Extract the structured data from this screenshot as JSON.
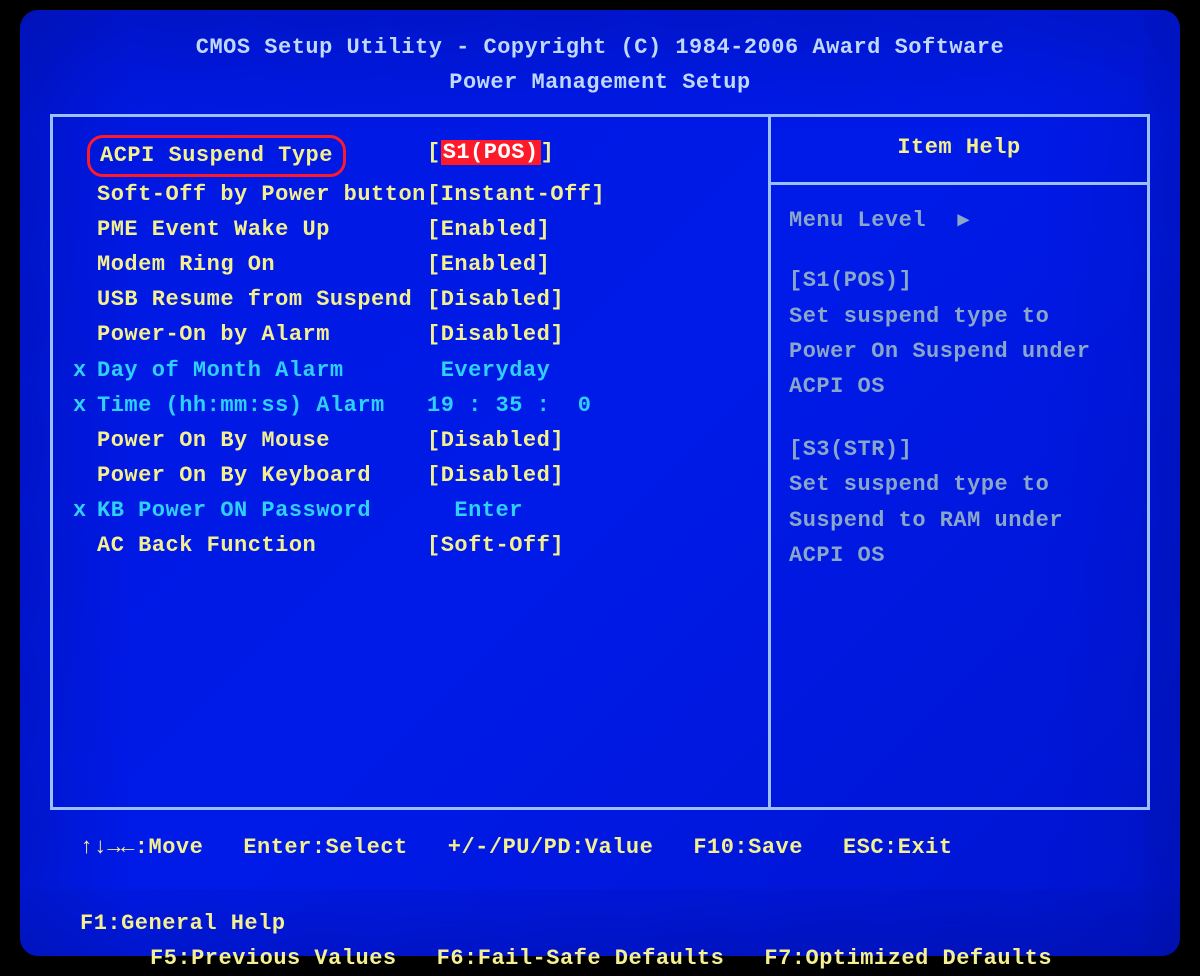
{
  "header": {
    "line1": "CMOS Setup Utility - Copyright (C) 1984-2006 Award Software",
    "line2": "Power Management Setup"
  },
  "items": [
    {
      "mark": "",
      "label": "ACPI Suspend Type",
      "value": "[",
      "sel": "S1(POS)",
      "tail": "]",
      "cls": "yellow",
      "selected": true
    },
    {
      "mark": "",
      "label": "Soft-Off by Power button",
      "value": "[Instant-Off]",
      "cls": "yellow"
    },
    {
      "mark": "",
      "label": "PME Event Wake Up",
      "value": "[Enabled]",
      "cls": "yellow"
    },
    {
      "mark": "",
      "label": "Modem Ring On",
      "value": "[Enabled]",
      "cls": "yellow"
    },
    {
      "mark": "",
      "label": "USB Resume from Suspend",
      "value": "[Disabled]",
      "cls": "yellow"
    },
    {
      "mark": "",
      "label": "Power-On by Alarm",
      "value": "[Disabled]",
      "cls": "yellow"
    },
    {
      "mark": "x",
      "label": "Day of Month Alarm",
      "value": " Everyday",
      "cls": "cyan"
    },
    {
      "mark": "x",
      "label": "Time (hh:mm:ss) Alarm",
      "value": "19 : 35 :  0",
      "cls": "cyan"
    },
    {
      "mark": "",
      "label": "Power On By Mouse",
      "value": "[Disabled]",
      "cls": "yellow"
    },
    {
      "mark": "",
      "label": "Power On By Keyboard",
      "value": "[Disabled]",
      "cls": "yellow"
    },
    {
      "mark": "x",
      "label": "KB Power ON Password",
      "value": "  Enter",
      "cls": "cyan"
    },
    {
      "mark": "",
      "label": "AC Back Function",
      "value": "[Soft-Off]",
      "cls": "yellow"
    }
  ],
  "help": {
    "title": "Item Help",
    "menu_level": "Menu Level",
    "arrow": "▸",
    "blocks": [
      {
        "head": "[S1(POS)]",
        "body": "Set suspend type to Power On Suspend under ACPI OS"
      },
      {
        "head": "[S3(STR)]",
        "body": "Set suspend type to Suspend to RAM under ACPI OS"
      }
    ]
  },
  "footer": {
    "l1": [
      "↑↓→←:Move",
      "Enter:Select",
      "+/-/PU/PD:Value",
      "F10:Save",
      "ESC:Exit",
      "F1:General Help"
    ],
    "l2": [
      "F5:Previous Values",
      "F6:Fail-Safe Defaults",
      "F7:Optimized Defaults"
    ]
  }
}
